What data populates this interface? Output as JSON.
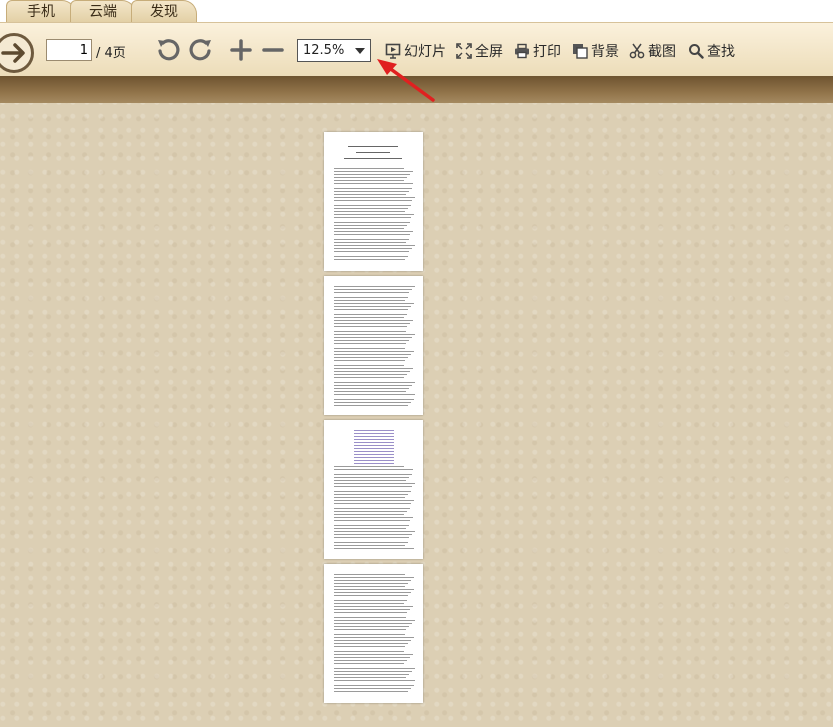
{
  "tabs": [
    {
      "label": "手机"
    },
    {
      "label": "云端"
    },
    {
      "label": "发现"
    }
  ],
  "toolbar": {
    "page_current": "1",
    "page_total": "/ 4页",
    "zoom_value": "12.5%",
    "buttons": [
      {
        "label": "幻灯片",
        "icon": "slideshow-icon"
      },
      {
        "label": "全屏",
        "icon": "fullscreen-icon"
      },
      {
        "label": "打印",
        "icon": "printer-icon"
      },
      {
        "label": "背景",
        "icon": "background-icon"
      },
      {
        "label": "截图",
        "icon": "scissors-icon"
      },
      {
        "label": "查找",
        "icon": "search-icon"
      }
    ]
  },
  "colors": {
    "annotation_arrow": "#e02020",
    "band": "#8e7047",
    "workspace": "#dccfb4"
  }
}
